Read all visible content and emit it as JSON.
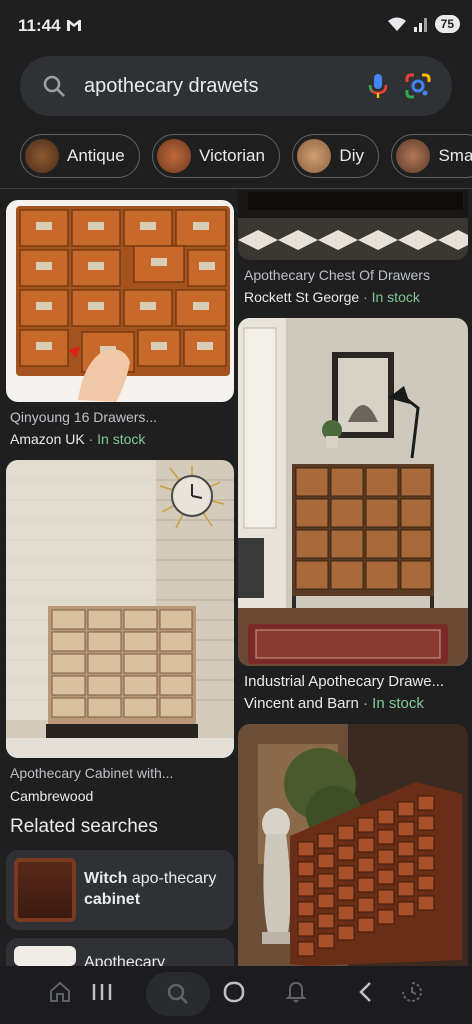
{
  "status": {
    "time": "11:44",
    "battery": "75"
  },
  "search": {
    "query": "apothecary drawets"
  },
  "chips": [
    {
      "label": "Antique"
    },
    {
      "label": "Victorian"
    },
    {
      "label": "Diy"
    },
    {
      "label": "Sma"
    }
  ],
  "results": [
    {
      "title": "Apothecary Chest Of Drawers",
      "source": "Rockett St George",
      "stock": "· In stock"
    },
    {
      "title": "Qinyoung 16 Drawers...",
      "source": "Amazon UK",
      "stock": "· In stock"
    },
    {
      "title": "Industrial Apothecary Drawe...",
      "source": "Vincent and Barn",
      "stock": "· In stock"
    },
    {
      "title": "Apothecary Cabinet with...",
      "source": "Cambrewood",
      "stock": ""
    }
  ],
  "related": {
    "heading": "Related searches",
    "items": [
      {
        "bold1": "Witch",
        "plain": " apo-thecary ",
        "bold2": "cabinet"
      },
      {
        "plain": "Apothecary"
      }
    ]
  },
  "colors": {
    "background": "#1f1f1f",
    "surface": "#303134",
    "in_stock": "#81c995"
  }
}
